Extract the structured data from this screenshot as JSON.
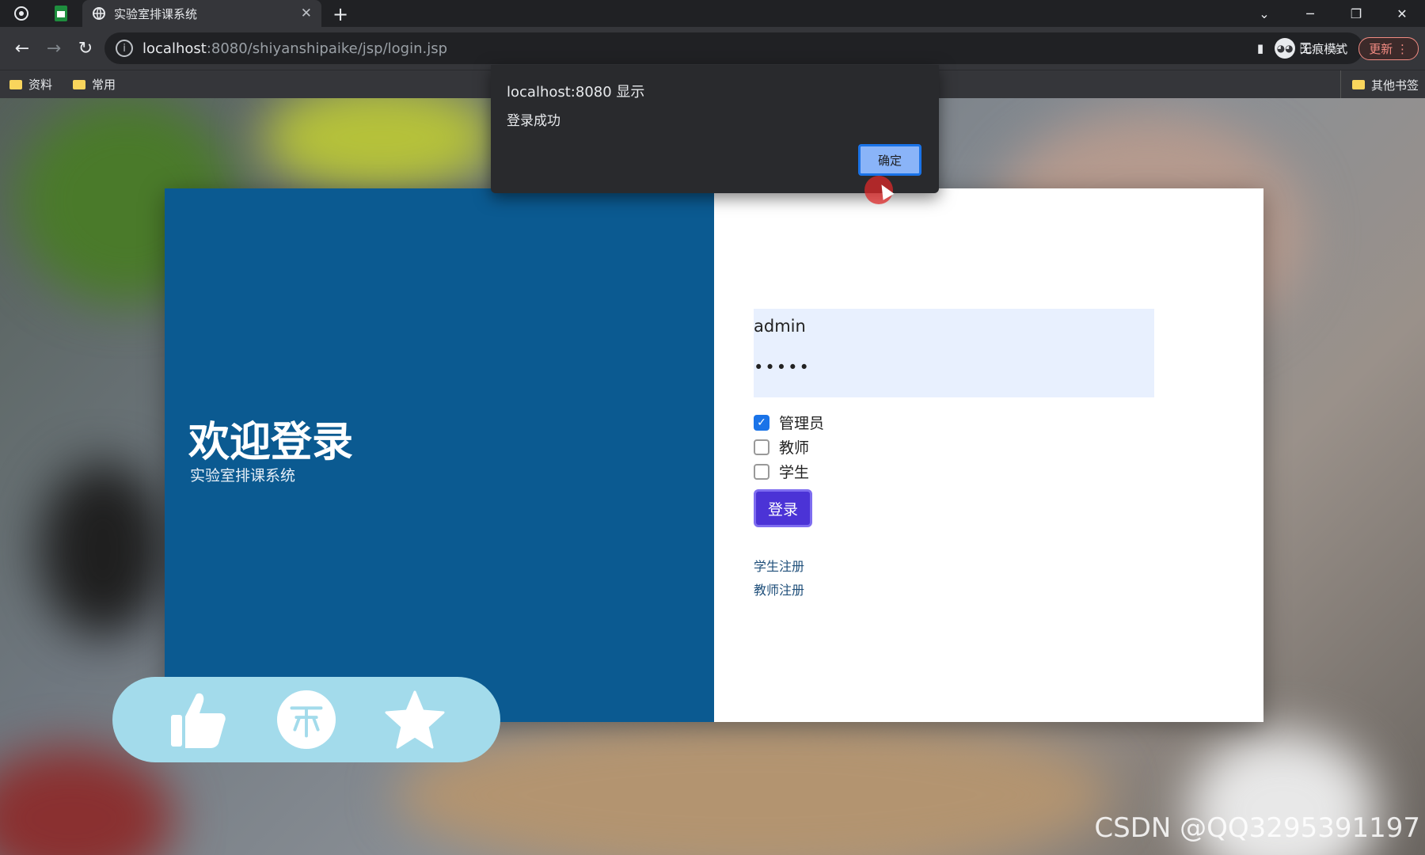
{
  "browser": {
    "tab_title": "实验室排课系统",
    "url_host": "localhost",
    "url_path": ":8080/shiyanshipaike/jsp/login.jsp",
    "incognito_label": "无痕模式",
    "update_label": "更新",
    "bookmarks": [
      "资料",
      "常用"
    ],
    "other_bookmarks": "其他书签"
  },
  "left_panel": {
    "title": "欢迎登录",
    "subtitle": "实验室排课系统",
    "color": "#0b5a91"
  },
  "form": {
    "username_value": "admin",
    "password_value": "•••••",
    "roles": [
      {
        "label": "管理员",
        "checked": true
      },
      {
        "label": "教师",
        "checked": false
      },
      {
        "label": "学生",
        "checked": false
      }
    ],
    "login_label": "登录",
    "links": [
      "学生注册",
      "教师注册"
    ]
  },
  "alert": {
    "title": "localhost:8080 显示",
    "message": "登录成功",
    "ok_label": "确定"
  },
  "watermark": "CSDN @QQ3295391197"
}
